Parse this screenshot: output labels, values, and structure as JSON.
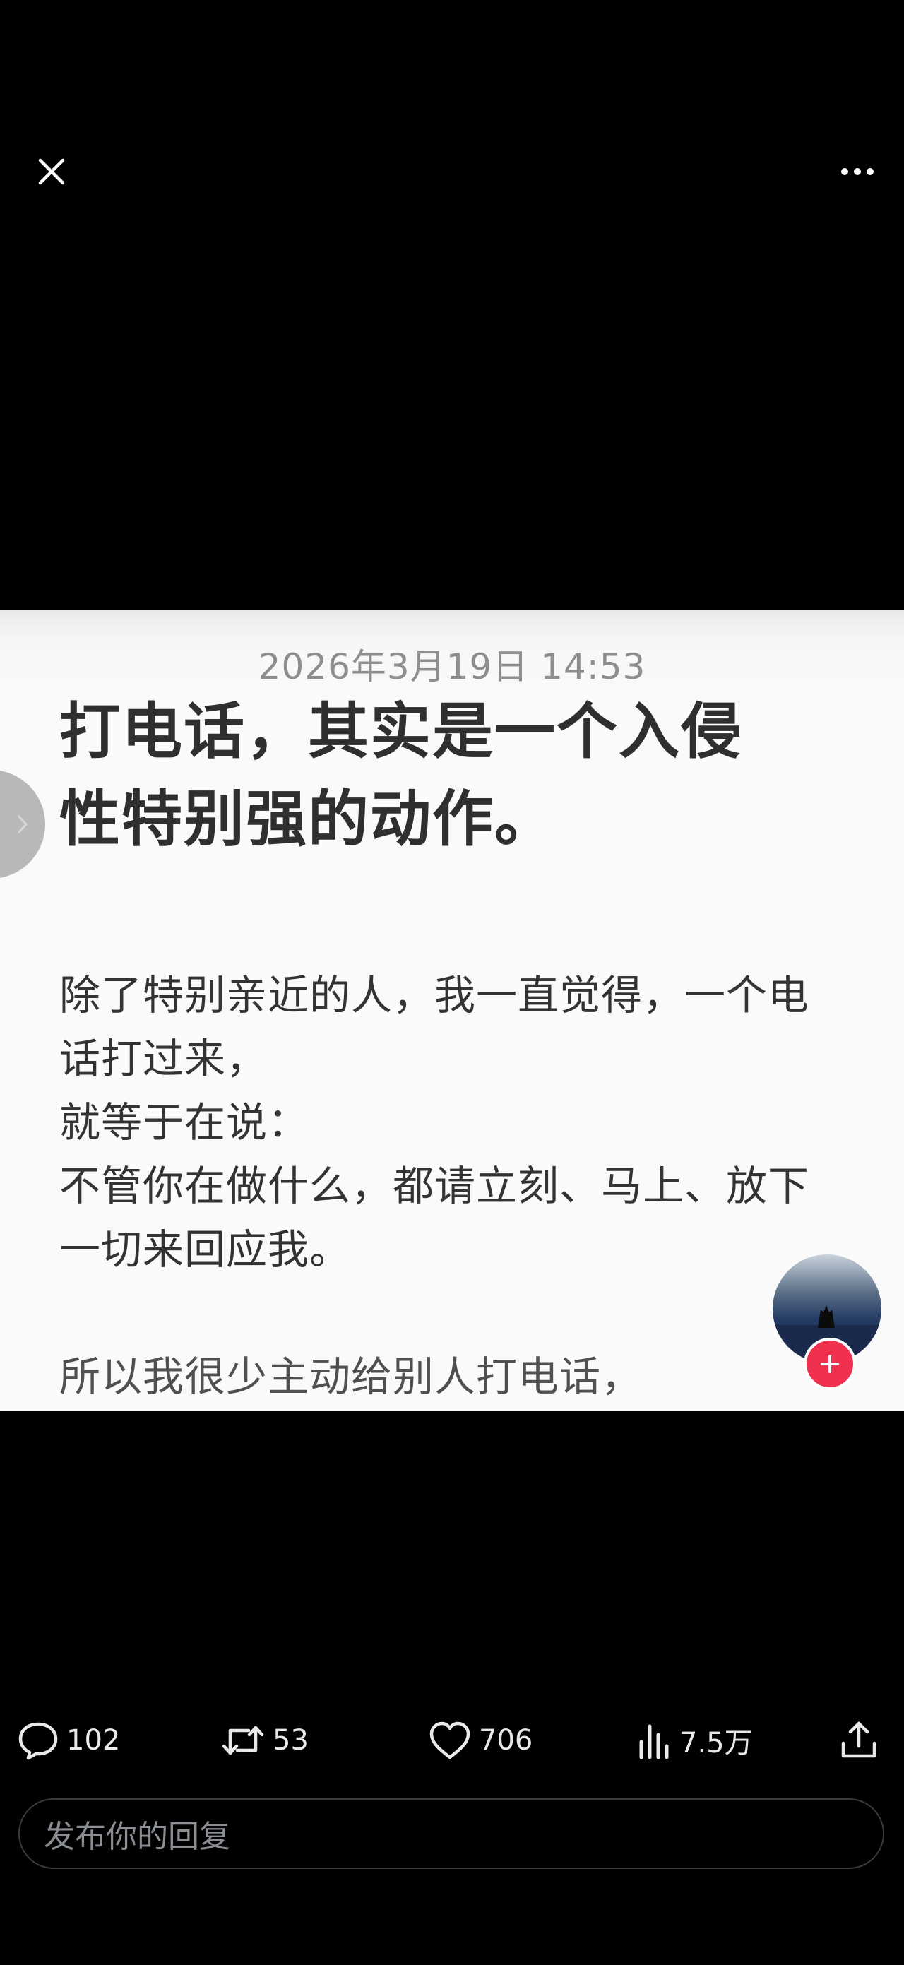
{
  "card": {
    "date": "2026年3月19日 14:53",
    "title_lines": [
      "打电话，其实是一个入侵",
      "性特别强的动作。"
    ],
    "body_lines": [
      "除了特别亲近的人，我一直觉得，一个电",
      "话打过来，",
      "就等于在说：",
      "不管你在做什么，都请立刻、马上、放下",
      "一切来回应我。",
      "",
      "所以我很少主动给别人打电话，"
    ]
  },
  "actions": {
    "reply_count": "102",
    "repost_count": "53",
    "like_count": "706",
    "view_count": "7.5万"
  },
  "reply": {
    "placeholder": "发布你的回复"
  },
  "colors": {
    "background": "#000000",
    "action_text": "#e7e9ea",
    "placeholder": "#8a8d91",
    "follow_badge": "#f0304f"
  },
  "icons": [
    "close-icon",
    "more-icon",
    "reply-icon",
    "repost-icon",
    "like-icon",
    "views-icon",
    "share-icon",
    "chevron-right-icon",
    "plus-icon"
  ]
}
